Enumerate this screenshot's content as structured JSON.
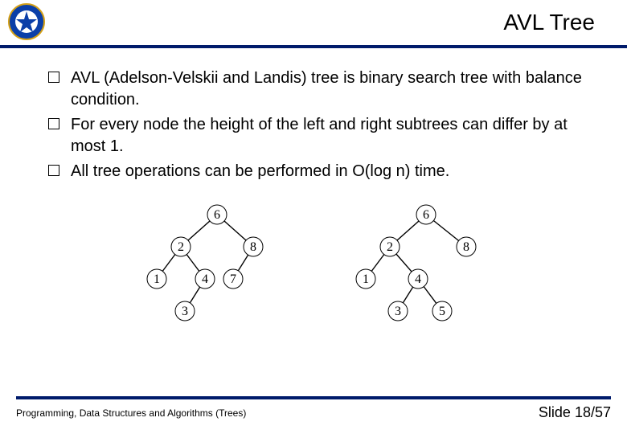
{
  "header": {
    "title": "AVL Tree"
  },
  "bullets": {
    "b1": "AVL (Adelson-Velskii and Landis) tree is binary search tree with balance condition.",
    "b2": "For every node the height of the left and right subtrees can differ by at most 1.",
    "b3": "All tree operations can be performed in O(log n) time."
  },
  "trees": {
    "left": {
      "n_root": "6",
      "n_l": "2",
      "n_r": "8",
      "n_ll": "1",
      "n_lr": "4",
      "n_rl": "7",
      "n_lrl": "3"
    },
    "right": {
      "n_root": "6",
      "n_l": "2",
      "n_r": "8",
      "n_ll": "1",
      "n_lr": "4",
      "n_lrl": "3",
      "n_lrr": "5"
    }
  },
  "footer": {
    "left": "Programming, Data Structures and Algorithms (Trees)",
    "right": "Slide 18/57"
  }
}
